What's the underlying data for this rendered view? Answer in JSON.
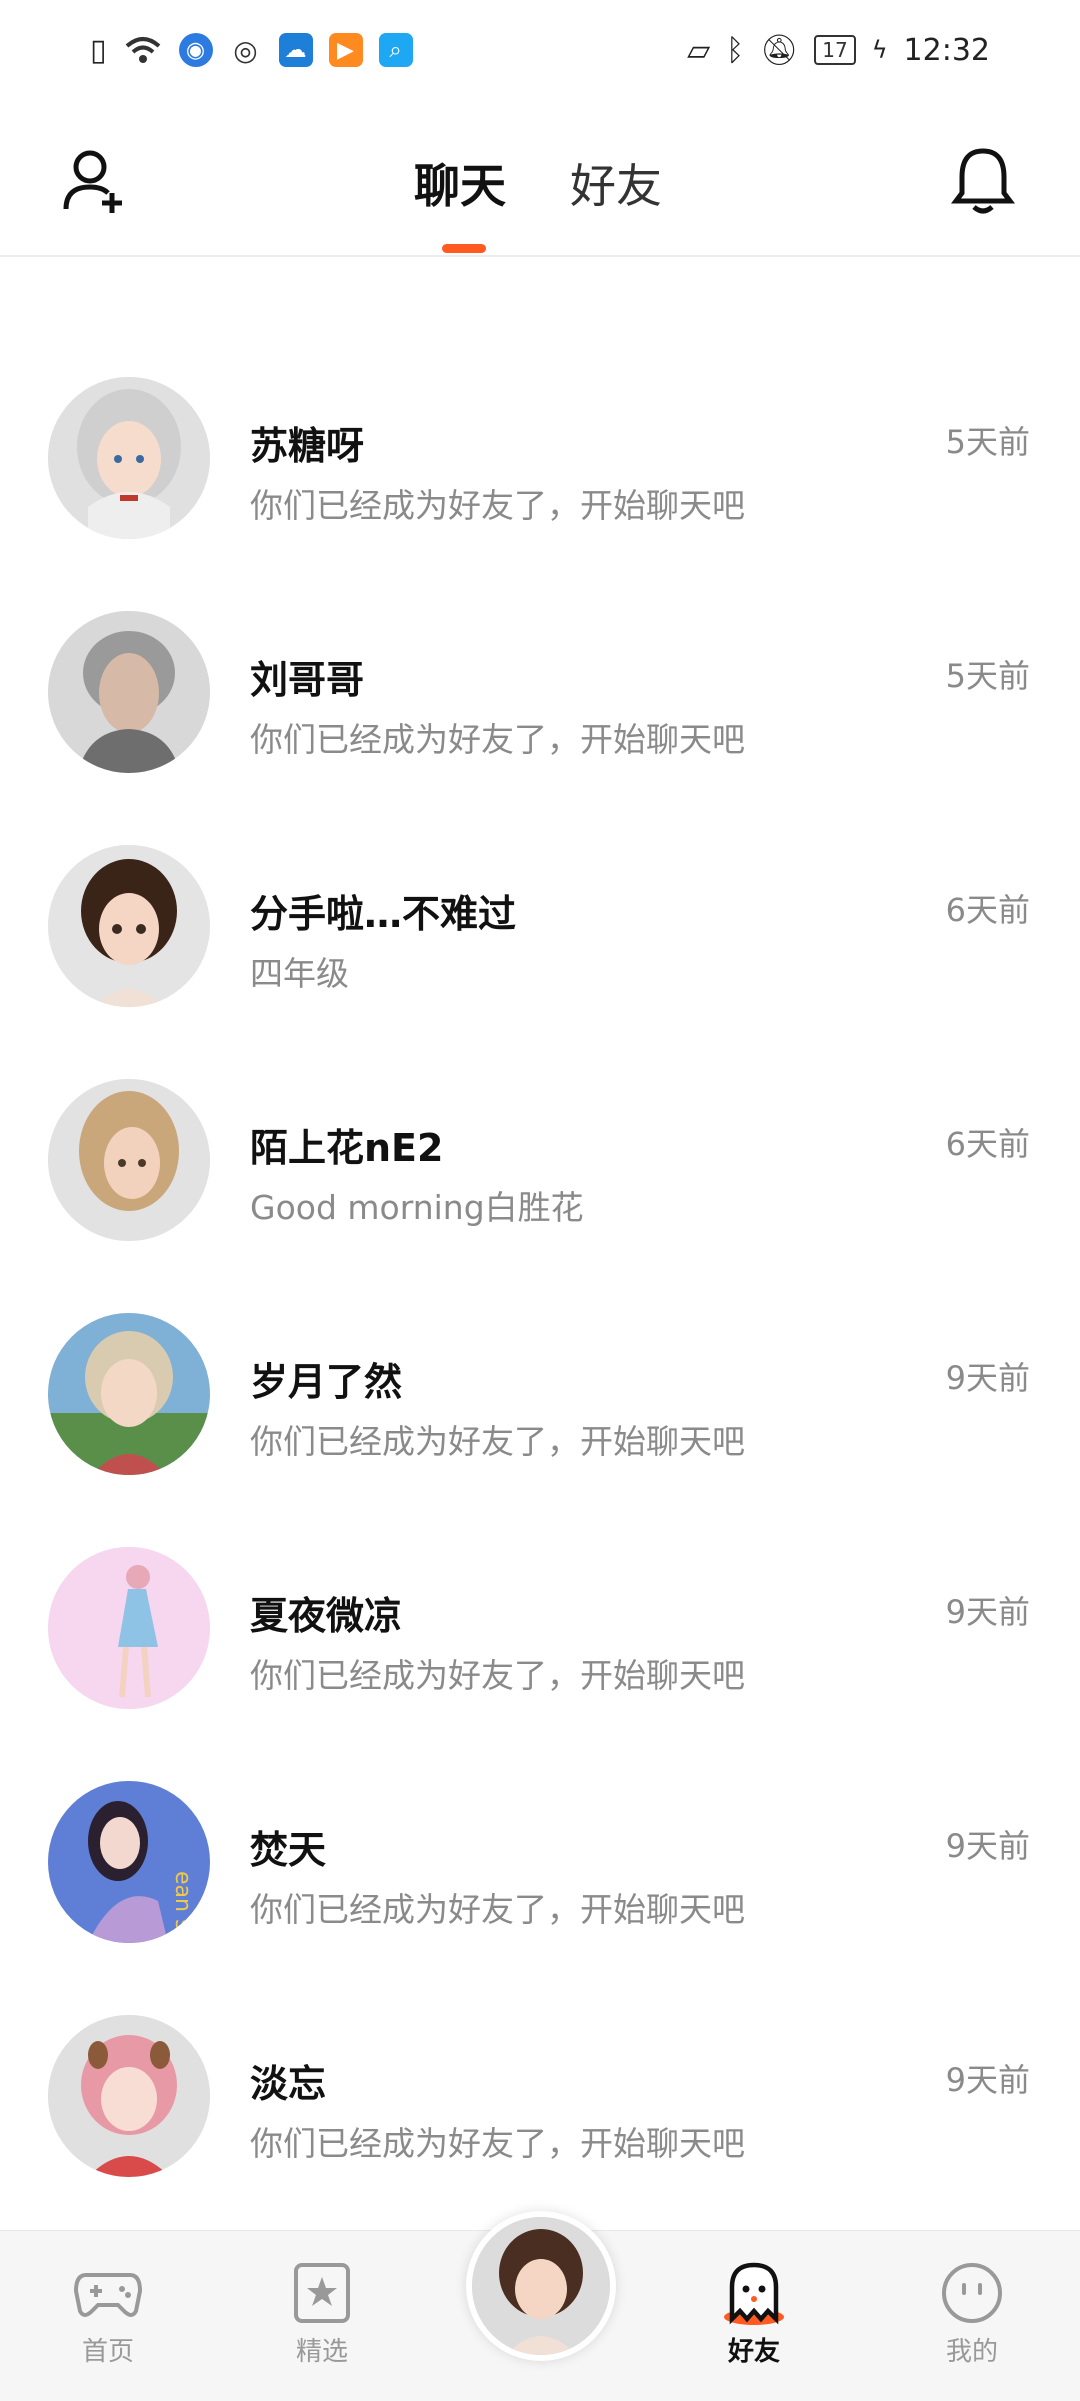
{
  "status_bar": {
    "time": "12:32",
    "battery": "17",
    "left_icons": [
      "sim-alert-icon",
      "wifi-icon",
      "browser-icon",
      "wechat-icon",
      "weather-icon",
      "video-icon",
      "search-app-icon"
    ],
    "right_icons": [
      "no-sim-icon",
      "bluetooth-icon",
      "mute-icon",
      "battery-icon",
      "charging-icon"
    ]
  },
  "header": {
    "tabs": [
      {
        "label": "聊天",
        "active": true
      },
      {
        "label": "好友",
        "active": false
      }
    ],
    "left_icon": "add-user-icon",
    "right_icon": "bell-icon",
    "accent": "#ff5a1f"
  },
  "chats": [
    {
      "name": "苏糖呀",
      "message": "你们已经成为好友了，开始聊天吧",
      "time": "5天前",
      "avatar_bg": "#dedede",
      "hair": "#cfcfcf"
    },
    {
      "name": "刘哥哥",
      "message": "你们已经成为好友了，开始聊天吧",
      "time": "5天前",
      "avatar_bg": "#d9d9d9",
      "hair": "#9a9a9a"
    },
    {
      "name": "分手啦…不难过",
      "message": "四年级",
      "time": "6天前",
      "avatar_bg": "#e4e4e4",
      "hair": "#3a2418"
    },
    {
      "name": "陌上花nE2",
      "message": "Good morning白胜花",
      "time": "6天前",
      "avatar_bg": "#e2e2e2",
      "hair": "#c9a77a"
    },
    {
      "name": "岁月了然",
      "message": "你们已经成为好友了，开始聊天吧",
      "time": "9天前",
      "avatar_bg": "#7fb0d6",
      "hair": "#d9cbb0"
    },
    {
      "name": "夏夜微凉",
      "message": "你们已经成为好友了，开始聊天吧",
      "time": "9天前",
      "avatar_bg": "#f6d7ef",
      "hair": "#e7a8b8"
    },
    {
      "name": "焚天",
      "message": "你们已经成为好友了，开始聊天吧",
      "time": "9天前",
      "avatar_bg": "#5f7fd6",
      "hair": "#2a2030"
    },
    {
      "name": "淡忘",
      "message": "你们已经成为好友了，开始聊天吧",
      "time": "9天前",
      "avatar_bg": "#e0e0e0",
      "hair": "#e79aa5"
    }
  ],
  "bottom_nav": [
    {
      "label": "首页",
      "icon": "gamepad-icon",
      "active": false
    },
    {
      "label": "精选",
      "icon": "star-icon",
      "active": false
    },
    {
      "label": "",
      "icon": "avatar",
      "active": false
    },
    {
      "label": "好友",
      "icon": "ghost-icon",
      "active": true
    },
    {
      "label": "我的",
      "icon": "face-icon",
      "active": false
    }
  ]
}
